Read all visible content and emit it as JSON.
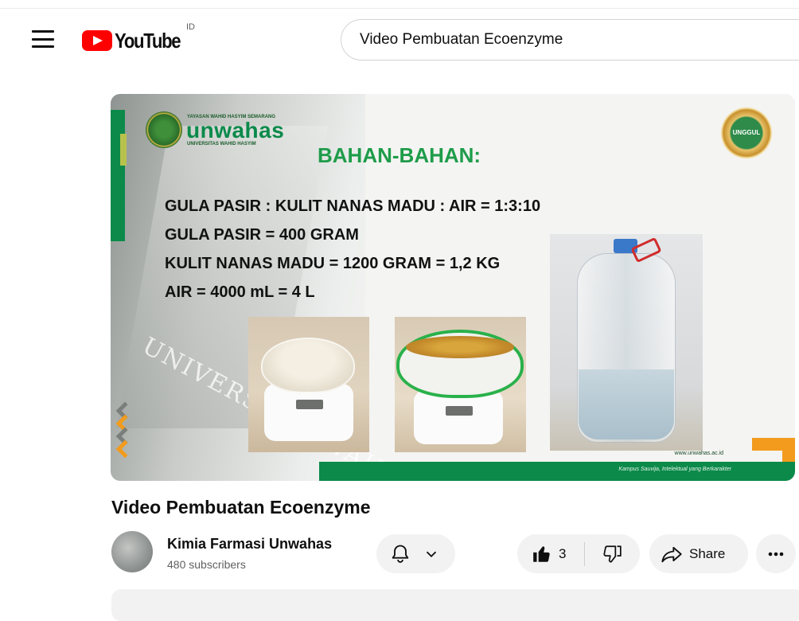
{
  "header": {
    "logo_text": "YouTube",
    "country_code": "ID",
    "search_value": "Video Pembuatan Ecoenzyme"
  },
  "slide": {
    "org_small": "YAYASAN WAHID HASYIM SEMARANG",
    "org_name": "unwahas",
    "org_sub": "UNIVERSITAS WAHID HASYIM",
    "badge": "UNGGUL",
    "title": "BAHAN-BAHAN:",
    "lines": [
      "GULA PASIR : KULIT NANAS MADU : AIR = 1:3:10",
      "GULA PASIR = 400 GRAM",
      "KULIT NANAS MADU = 1200 GRAM = 1,2 KG",
      "AIR = 4000 mL = 4 L"
    ],
    "watermark": "UNIVERSITAS WAHID HASYIM",
    "url": "www.unwahas.ac.id",
    "tagline": "Kampus Sauvija, Intelektual yang Berkarakter",
    "colors": {
      "green": "#0b8a4a",
      "title_green": "#1e9c4a",
      "orange": "#f29b1d"
    }
  },
  "video": {
    "title": "Video Pembuatan Ecoenzyme",
    "channel": "Kimia Farmasi Unwahas",
    "subscribers": "480 subscribers",
    "like_count": "3",
    "share_label": "Share"
  }
}
